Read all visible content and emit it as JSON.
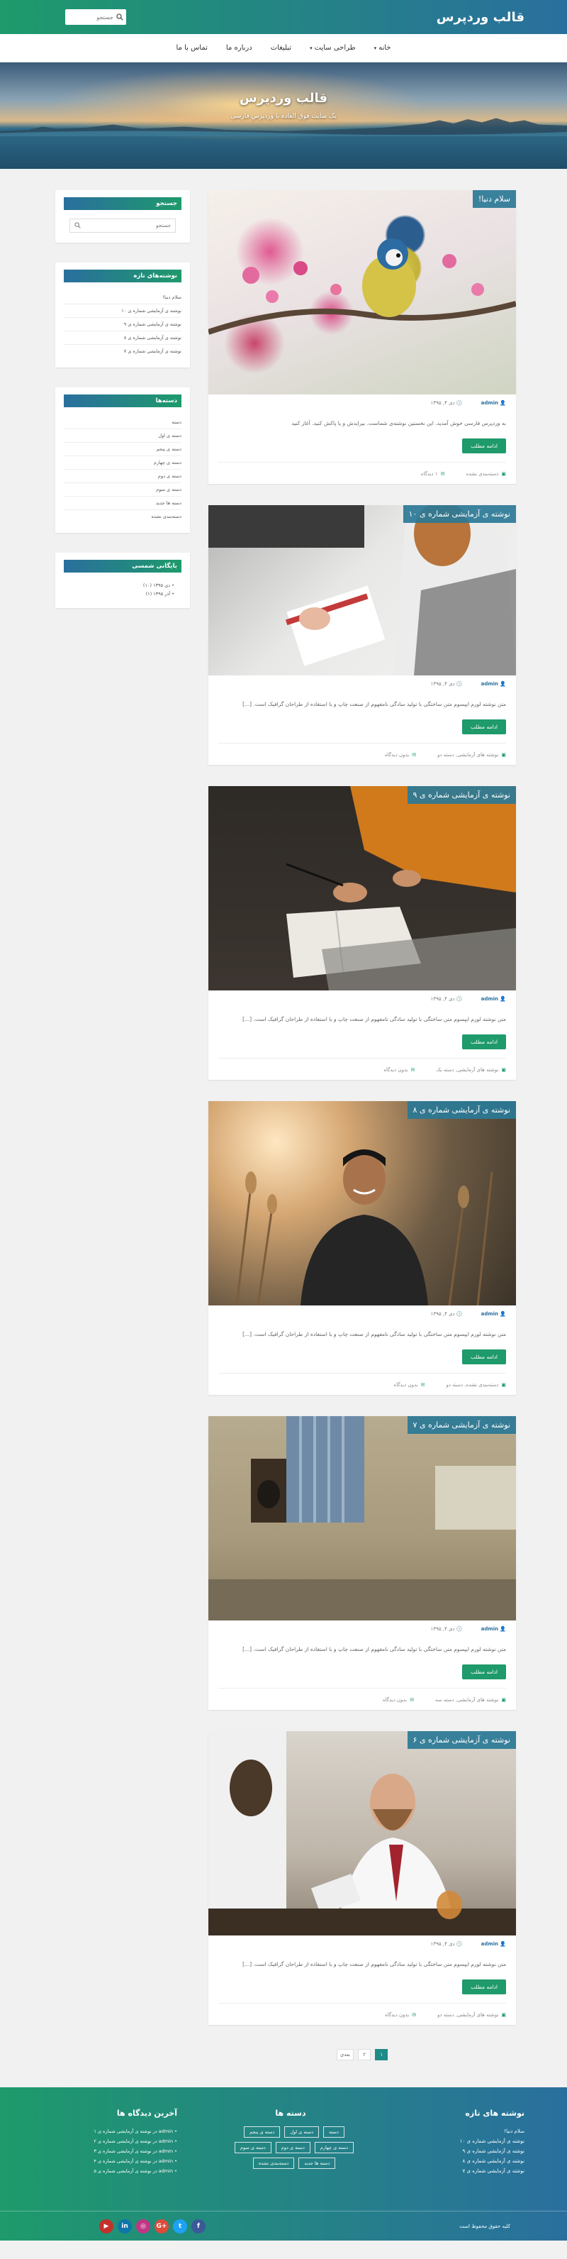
{
  "header": {
    "site_title": "قالب وردپرس",
    "search_placeholder": "جستجو"
  },
  "nav": {
    "items": [
      {
        "label": "خانه",
        "has_caret": true
      },
      {
        "label": "طراحی سایت",
        "has_caret": true
      },
      {
        "label": "تبلیغات",
        "has_caret": false
      },
      {
        "label": "درباره ما",
        "has_caret": false
      },
      {
        "label": "تماس با ما",
        "has_caret": false
      }
    ]
  },
  "hero": {
    "title": "قالب وردپرس",
    "subtitle": "یک سایت فوق العاده با وردپرس فارسی"
  },
  "posts": [
    {
      "title": "سلام دنیا!",
      "author": "admin",
      "date": "دی ۴, ۱۳۹۵",
      "excerpt": "به وردپرس فارسی خوش آمدید. این نخستین نوشته‌ی شماست. بیرایدش و یا پاکش کنید. آغاز کنید",
      "more": "ادامه مطلب",
      "category": "دسته‌بندی نشده",
      "comments": "۱ دیدگاه"
    },
    {
      "title": "نوشته ی آزمایشی شماره ی ۱۰",
      "author": "admin",
      "date": "دی ۴, ۱۳۹۵",
      "excerpt": "متن نوشته لورم ایپسوم متن ساختگی با تولید سادگی نامفهوم از صنعت چاپ و با استفاده از طراحان گرافیک است. [...]",
      "more": "ادامه مطلب",
      "category": "نوشته های آزمایشی, دسته دو",
      "comments": "بدون دیدگاه"
    },
    {
      "title": "نوشته ی آزمایشی شماره ی ۹",
      "author": "admin",
      "date": "دی ۴, ۱۳۹۵",
      "excerpt": "متن نوشته لورم ایپسوم متن ساختگی با تولید سادگی نامفهوم از صنعت چاپ و با استفاده از طراحان گرافیک است. [...]",
      "more": "ادامه مطلب",
      "category": "نوشته های آزمایشی, دسته یک",
      "comments": "بدون دیدگاه"
    },
    {
      "title": "نوشته ی آزمایشی شماره ی ۸",
      "author": "admin",
      "date": "دی ۴, ۱۳۹۵",
      "excerpt": "متن نوشته لورم ایپسوم متن ساختگی با تولید سادگی نامفهوم از صنعت چاپ و با استفاده از طراحان گرافیک است. [...]",
      "more": "ادامه مطلب",
      "category": "دسته‌بندی نشده, دسته دو",
      "comments": "بدون دیدگاه"
    },
    {
      "title": "نوشته ی آزمایشی شماره ی ۷",
      "author": "admin",
      "date": "دی ۴, ۱۳۹۵",
      "excerpt": "متن نوشته لورم ایپسوم متن ساختگی با تولید سادگی نامفهوم از صنعت چاپ و با استفاده از طراحان گرافیک است. [...]",
      "more": "ادامه مطلب",
      "category": "نوشته های آزمایشی, دسته سه",
      "comments": "بدون دیدگاه"
    },
    {
      "title": "نوشته ی آزمایشی شماره ی ۶",
      "author": "admin",
      "date": "دی ۴, ۱۳۹۵",
      "excerpt": "متن نوشته لورم ایپسوم متن ساختگی با تولید سادگی نامفهوم از صنعت چاپ و با استفاده از طراحان گرافیک است. [...]",
      "more": "ادامه مطلب",
      "category": "نوشته های آزمایشی, دسته دو",
      "comments": "بدون دیدگاه"
    }
  ],
  "pagination": {
    "pages": [
      "۱",
      "۲"
    ],
    "next": "بعدی"
  },
  "sidebar": {
    "search": {
      "title": "جستجو",
      "placeholder": "جستجو"
    },
    "recent": {
      "title": "نوشته‌های تازه",
      "items": [
        "سلام دنیا!",
        "نوشته ی آزمایشی شماره ی ۱۰",
        "نوشته ی آزمایشی شماره ی ۹",
        "نوشته ی آزمایشی شماره ی ۸",
        "نوشته ی آزمایشی شماره ی ۷"
      ]
    },
    "categories": {
      "title": "دسته‌ها",
      "items": [
        "دسته",
        "دسته ی اول",
        "دسته ی پنجم",
        "دسته ی چهارم",
        "دسته ی دوم",
        "دسته ی سوم",
        "دسته ها جدید",
        "دسته‌بندی نشده"
      ]
    },
    "archive": {
      "title": "بایگانی شمسی",
      "items": [
        "دی ۱۳۹۵ (۱۰)",
        "آذر ۱۳۹۵ (۱)"
      ]
    }
  },
  "footer": {
    "recent": {
      "title": "نوشته های تازه",
      "items": [
        "سلام دنیا!",
        "نوشته ی آزمایشی شماره ی ۱۰",
        "نوشته ی آزمایشی شماره ی ۹",
        "نوشته ی آزمایشی شماره ی ۸",
        "نوشته ی آزمایشی شماره ی ۷"
      ]
    },
    "categories": {
      "title": "دسته ها",
      "items": [
        "دسته",
        "دسته ی اول",
        "دسته ی پنجم",
        "دسته ی چهارم",
        "دسته ی دوم",
        "دسته ی سوم",
        "دسته ها جدید",
        "دسته‌بندی نشده"
      ]
    },
    "comments": {
      "title": "آخرین دیدگاه ها",
      "items": [
        "admin در نوشته ی آزمایشی شماره ی ۱",
        "admin در نوشته ی آزمایشی شماره ی ۲",
        "admin در نوشته ی آزمایشی شماره ی ۳",
        "admin در نوشته ی آزمایشی شماره ی ۴",
        "admin در نوشته ی آزمایشی شماره ی ۵"
      ]
    },
    "copyright": "کلیه حقوق محفوظ است",
    "socials": [
      "facebook-icon",
      "twitter-icon",
      "google-plus-icon",
      "instagram-icon",
      "linkedin-icon",
      "youtube-icon"
    ]
  },
  "colors": {
    "brand_green": "#1e9a6b",
    "brand_blue": "#2a6f9e"
  }
}
